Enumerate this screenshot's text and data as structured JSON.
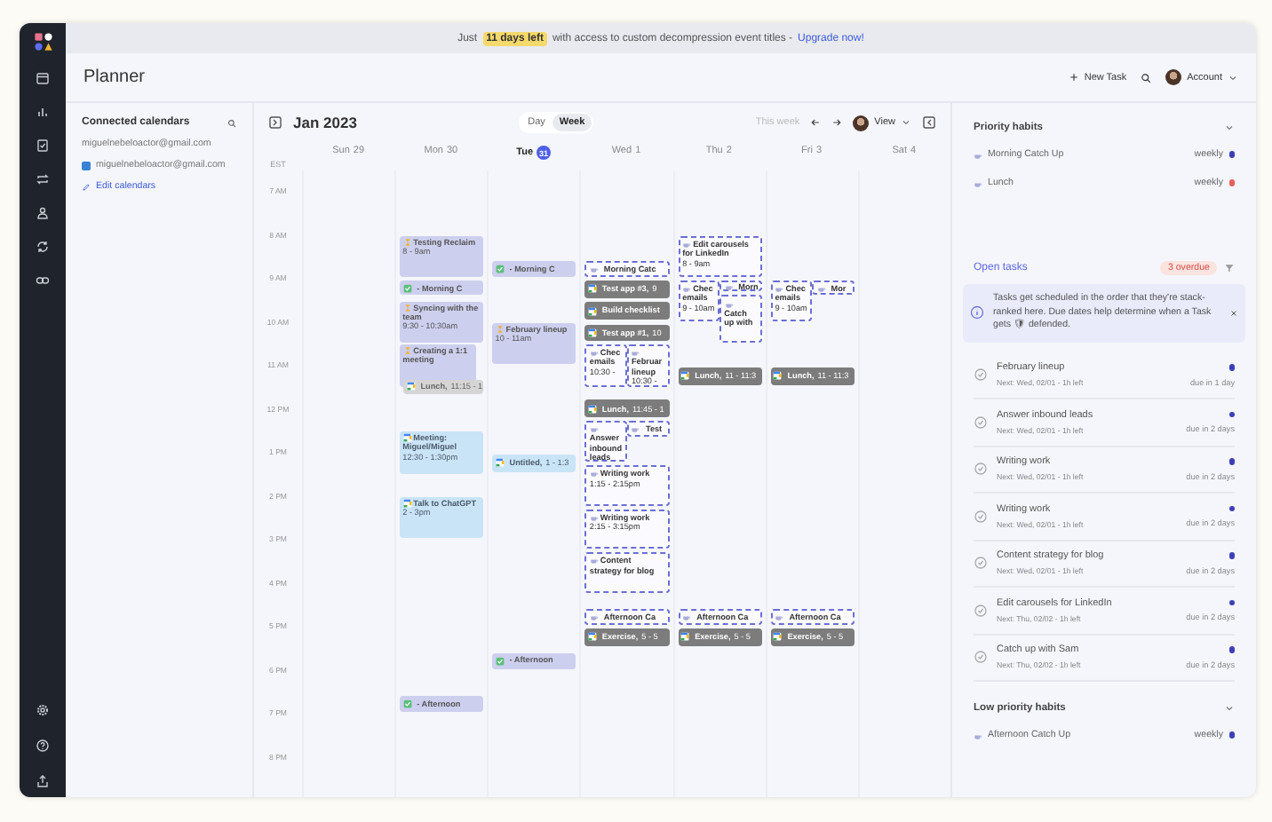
{
  "banner": {
    "prefix": "Just",
    "highlight": "11 days left",
    "suffix": "with access to custom decompression event titles -",
    "link": "Upgrade now!"
  },
  "header": {
    "title": "Planner",
    "new_task": "New Task",
    "account": "Account"
  },
  "calendars": {
    "title": "Connected calendars",
    "account": "miguelnebeloactor@gmail.com",
    "items": [
      {
        "name": "miguelnebeloactor@gmail.com",
        "color": "#3b82d6"
      }
    ],
    "edit": "Edit calendars"
  },
  "toolbar": {
    "month": "Jan 2023",
    "views": [
      {
        "label": "Day",
        "selected": false
      },
      {
        "label": "Week",
        "selected": true
      }
    ],
    "this_week": "This week",
    "view": "View"
  },
  "timezone": "EST",
  "hours": [
    "7 AM",
    "8 AM",
    "9 AM",
    "10 AM",
    "11 AM",
    "12 PM",
    "1 PM",
    "2 PM",
    "3 PM",
    "4 PM",
    "5 PM",
    "6 PM",
    "7 PM",
    "8 PM"
  ],
  "days": [
    {
      "name": "Sun",
      "date": "29",
      "today": false
    },
    {
      "name": "Mon",
      "date": "30",
      "today": false,
      "events": [
        {
          "kind": "task",
          "title": "Testing Reclaim",
          "time": "8 - 9am"
        },
        {
          "kind": "done",
          "title": "- Morning C"
        },
        {
          "kind": "task",
          "title": "Syncing with the team",
          "time": "9:30 - 10:30am"
        },
        {
          "kind": "task",
          "title": "Creating a 1:1 meeting"
        },
        {
          "kind": "busy",
          "title": "Lunch,",
          "time": "11:15 - 1"
        },
        {
          "kind": "meeting",
          "title": "Meeting: Miguel/Miguel",
          "time": "12:30 - 1:30pm"
        },
        {
          "kind": "meeting",
          "title": "Talk to ChatGPT",
          "time": "2 - 3pm"
        },
        {
          "kind": "done",
          "title": "- Afternoon"
        }
      ]
    },
    {
      "name": "Tue",
      "date": "31",
      "today": true,
      "events": [
        {
          "kind": "done",
          "title": "- Morning C"
        },
        {
          "kind": "task",
          "title": "February lineup",
          "time": "10 - 11am"
        },
        {
          "kind": "meeting",
          "title": "Untitled,",
          "time": "1 - 1:3"
        },
        {
          "kind": "done",
          "title": "- Afternoon"
        }
      ]
    },
    {
      "name": "Wed",
      "date": "1",
      "today": false,
      "events": [
        {
          "kind": "habit",
          "title": "Morning Catc"
        },
        {
          "kind": "gcal",
          "title": "Test app #3,",
          "time": "9"
        },
        {
          "kind": "gcal",
          "title": "Build checklist"
        },
        {
          "kind": "gcal",
          "title": "Test app #1,",
          "time": "10"
        },
        {
          "kind": "habit",
          "title": "Chec emails",
          "time": "10:30 -"
        },
        {
          "kind": "habit",
          "title": "Februar lineup",
          "time": "10:30 -"
        },
        {
          "kind": "gcal",
          "title": "Lunch,",
          "time": "11:45 - 1"
        },
        {
          "kind": "habit",
          "title": "Answer inbound leads"
        },
        {
          "kind": "habit",
          "title": "Test"
        },
        {
          "kind": "habit",
          "title": "Writing work",
          "time": "1:15 - 2:15pm"
        },
        {
          "kind": "habit",
          "title": "Writing work",
          "time": "2:15 - 3:15pm"
        },
        {
          "kind": "habit",
          "title": "Content strategy for blog"
        },
        {
          "kind": "habit",
          "title": "Afternoon Ca"
        },
        {
          "kind": "gcal",
          "title": "Exercise,",
          "time": "5 - 5"
        }
      ]
    },
    {
      "name": "Thu",
      "date": "2",
      "today": false,
      "events": [
        {
          "kind": "habit",
          "title": "Edit carousels for LinkedIn",
          "time": "8 - 9am"
        },
        {
          "kind": "habit",
          "title": "Chec emails",
          "time": "9 - 10am"
        },
        {
          "kind": "habit",
          "title": "Morn"
        },
        {
          "kind": "habit",
          "title": "Catch up with"
        },
        {
          "kind": "gcal",
          "title": "Lunch,",
          "time": "11 - 11:3"
        },
        {
          "kind": "habit",
          "title": "Afternoon Ca"
        },
        {
          "kind": "gcal",
          "title": "Exercise,",
          "time": "5 - 5"
        }
      ]
    },
    {
      "name": "Fri",
      "date": "3",
      "today": false,
      "events": [
        {
          "kind": "habit",
          "title": "Chec emails",
          "time": "9 - 10am"
        },
        {
          "kind": "habit",
          "title": "Mor"
        },
        {
          "kind": "gcal",
          "title": "Lunch,",
          "time": "11 - 11:3"
        },
        {
          "kind": "habit",
          "title": "Afternoon Ca"
        },
        {
          "kind": "gcal",
          "title": "Exercise,",
          "time": "5 - 5"
        }
      ]
    },
    {
      "name": "Sat",
      "date": "4",
      "today": false
    }
  ],
  "priority_habits": {
    "title": "Priority habits",
    "items": [
      {
        "name": "Morning Catch Up",
        "frequency": "weekly",
        "color": "#3d3fb8"
      },
      {
        "name": "Lunch",
        "frequency": "weekly",
        "color": "#e8605a"
      }
    ]
  },
  "open_tasks": {
    "title": "Open tasks",
    "overdue": "3 overdue",
    "info": "Tasks get scheduled in the order that they're stack-ranked here. Due dates help determine when a Task gets 🛡 defended.",
    "items": [
      {
        "title": "February lineup",
        "next": "Next: Wed, 02/01 - 1h left",
        "due": "due in 1 day",
        "color": "#3d3fb8"
      },
      {
        "title": "Answer inbound leads",
        "next": "Next: Wed, 02/01 - 1h left",
        "due": "due in 2 days",
        "color": "#3d3fb8"
      },
      {
        "title": "Writing work",
        "next": "Next: Wed, 02/01 - 1h left",
        "due": "due in 2 days",
        "color": "#3d3fb8"
      },
      {
        "title": "Writing work",
        "next": "Next: Wed, 02/01 - 1h left",
        "due": "due in 2 days",
        "color": "#3d3fb8"
      },
      {
        "title": "Content strategy for blog",
        "next": "Next: Wed, 02/01 - 1h left",
        "due": "due in 2 days",
        "color": "#3d3fb8"
      },
      {
        "title": "Edit carousels for LinkedIn",
        "next": "Next: Thu, 02/02 - 1h left",
        "due": "due in 2 days",
        "color": "#3d3fb8"
      },
      {
        "title": "Catch up with Sam",
        "next": "Next: Thu, 02/02 - 1h left",
        "due": "due in 2 days",
        "color": "#3d3fb8"
      }
    ]
  },
  "low_priority_habits": {
    "title": "Low priority habits",
    "items": [
      {
        "name": "Afternoon Catch Up",
        "frequency": "weekly",
        "color": "#3d3fb8"
      }
    ]
  }
}
